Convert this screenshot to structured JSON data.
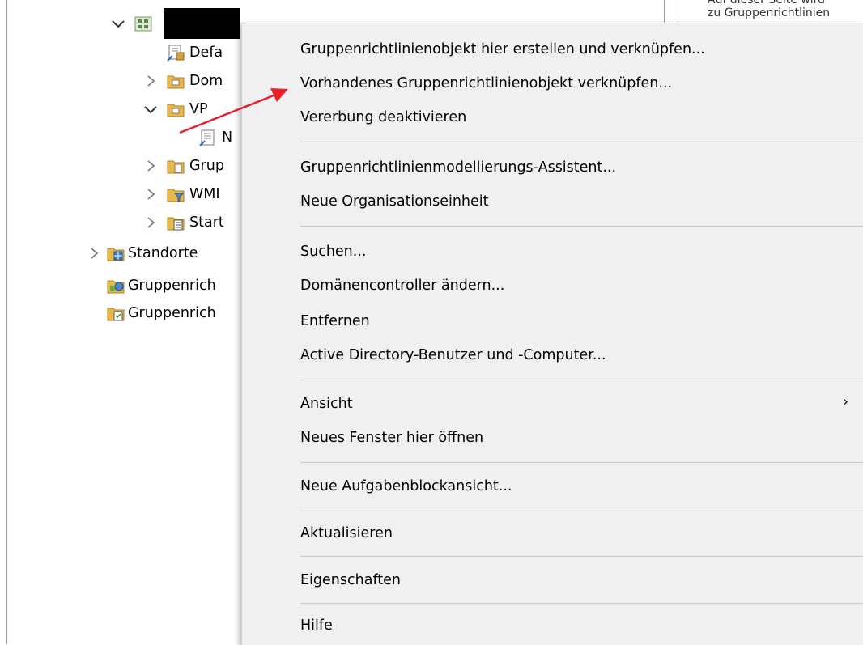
{
  "tree": {
    "domain_name": "",
    "items": [
      {
        "label": "Defa"
      },
      {
        "label": "Dom"
      },
      {
        "label": "VP"
      },
      {
        "label": "N"
      },
      {
        "label": "Grup"
      },
      {
        "label": "WMI"
      },
      {
        "label": "Start"
      },
      {
        "label": "Standorte"
      },
      {
        "label": "Gruppenrich"
      },
      {
        "label": "Gruppenrich"
      }
    ]
  },
  "right_pane": {
    "line1": "Auf dieser Seite wird",
    "line2": "zu Gruppenrichtlinien"
  },
  "context_menu": {
    "items": [
      {
        "label": "Gruppenrichtlinienobjekt hier erstellen und verknüpfen..."
      },
      {
        "label": "Vorhandenes Gruppenrichtlinienobjekt verknüpfen..."
      },
      {
        "label": "Vererbung deaktivieren"
      },
      {
        "label": "Gruppenrichtlinienmodellierungs-Assistent..."
      },
      {
        "label": "Neue Organisationseinheit"
      },
      {
        "label": "Suchen..."
      },
      {
        "label": "Domänencontroller ändern..."
      },
      {
        "label": "Entfernen"
      },
      {
        "label": "Active Directory-Benutzer und -Computer..."
      },
      {
        "label": "Ansicht",
        "submenu_glyph": "›"
      },
      {
        "label": "Neues Fenster hier öffnen"
      },
      {
        "label": "Neue Aufgabenblockansicht..."
      },
      {
        "label": "Aktualisieren"
      },
      {
        "label": "Eigenschaften"
      },
      {
        "label": "Hilfe"
      }
    ]
  },
  "colors": {
    "menu_bg": "#f0f0f0",
    "separator": "#c9c9c9",
    "annotation_arrow": "#e8202a",
    "folder": "#e8b84a"
  }
}
